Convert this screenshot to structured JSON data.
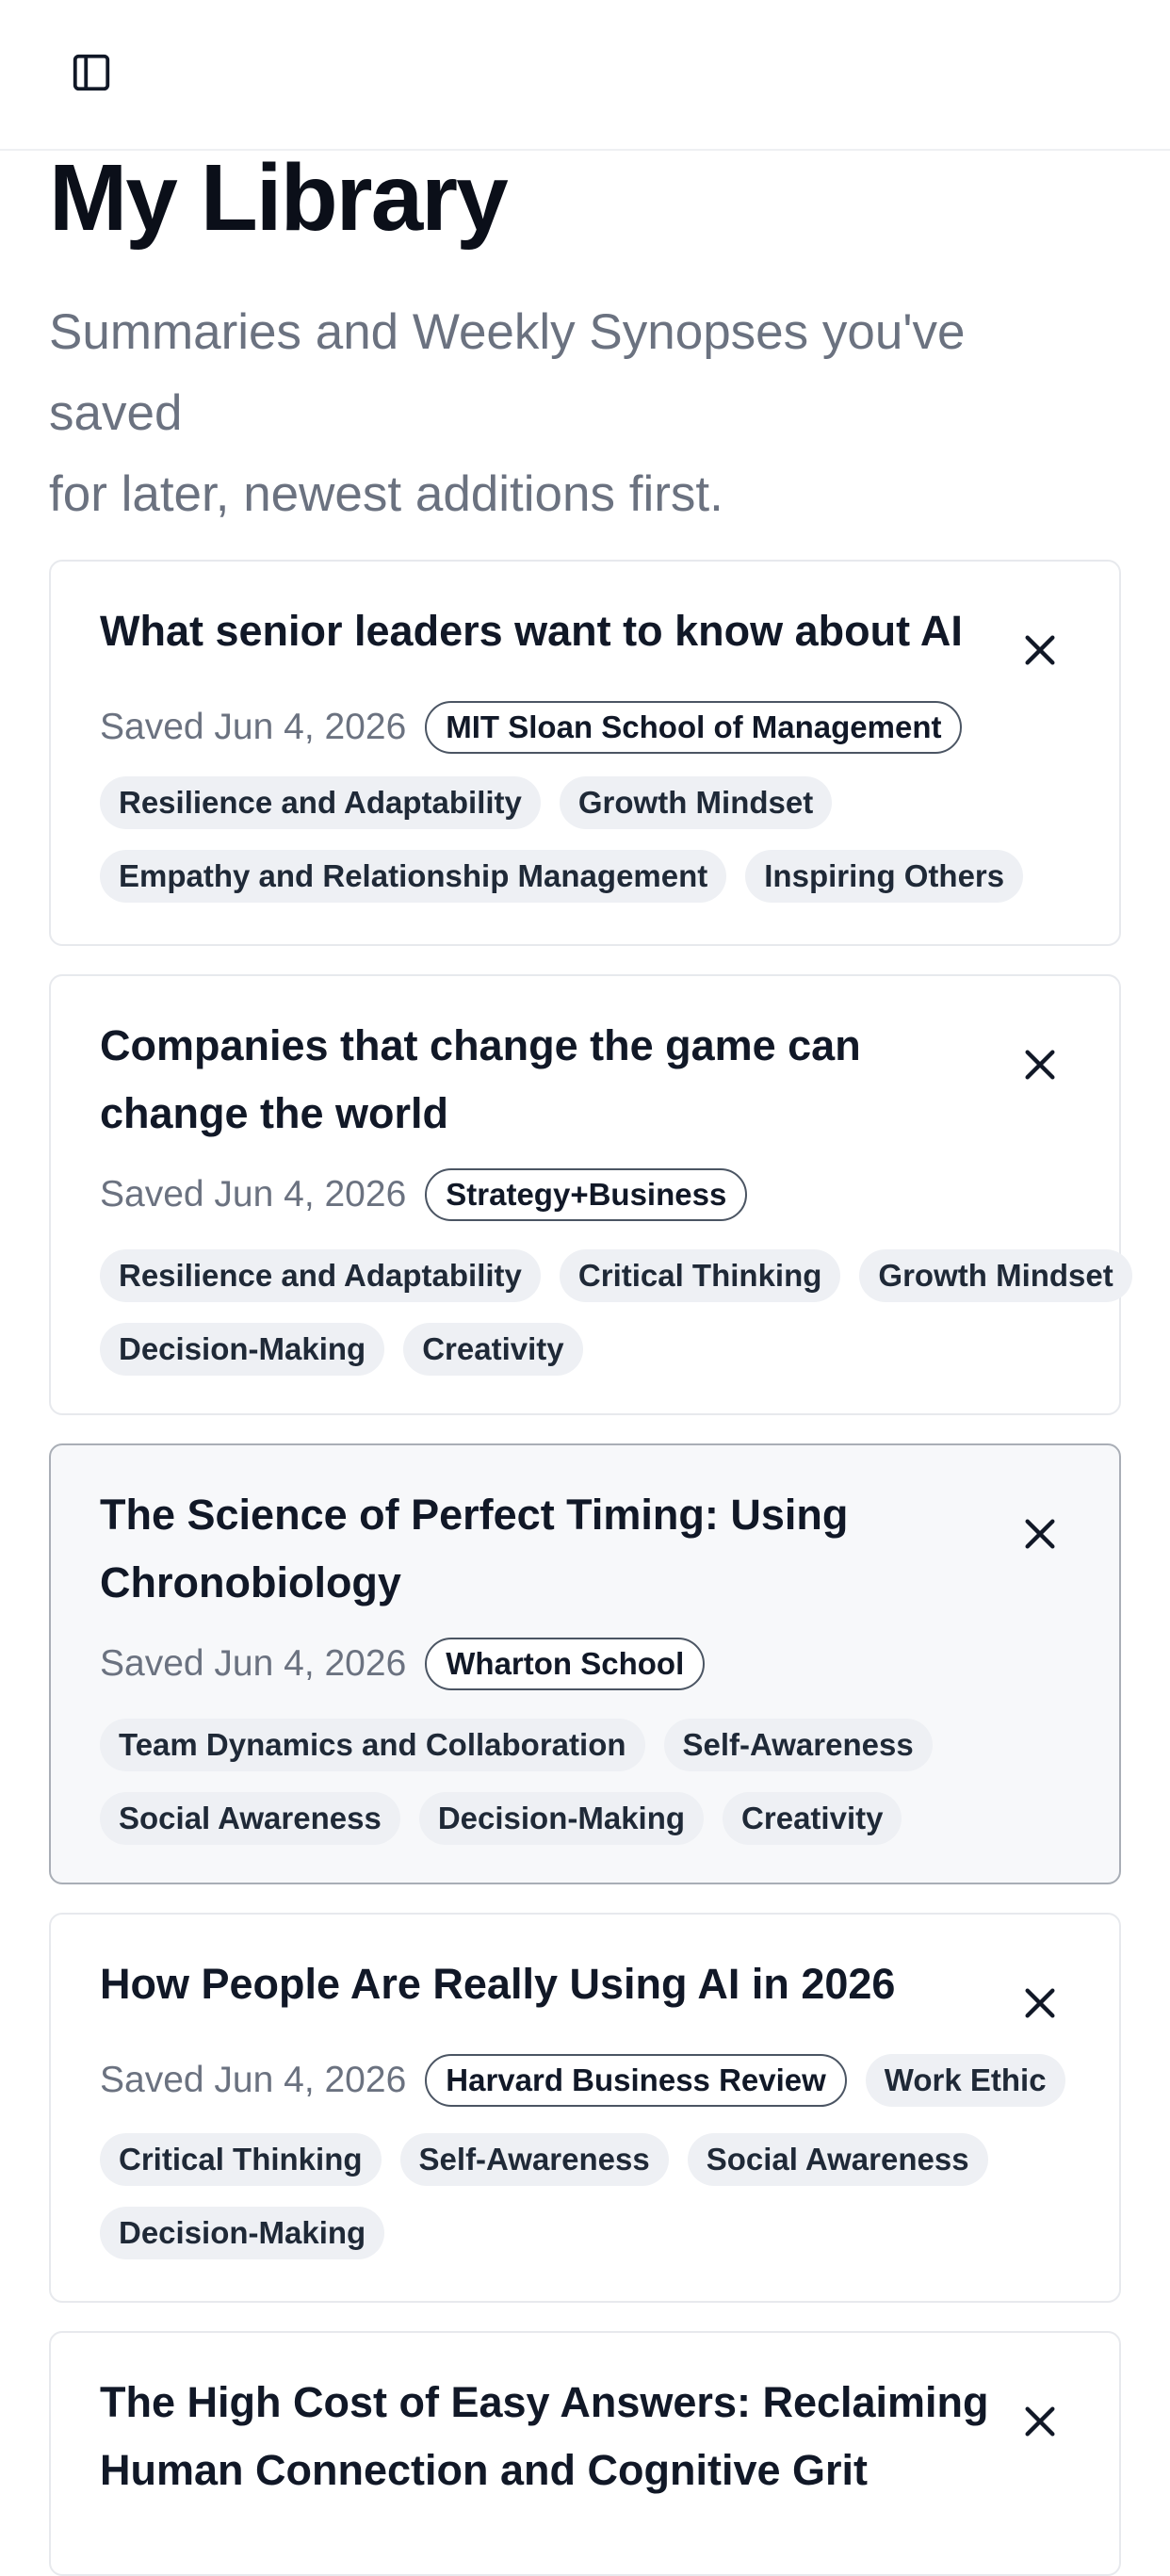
{
  "header": {
    "sidebar_icon": "sidebar-panel-icon"
  },
  "page": {
    "title": "My Library",
    "subtitle_line1": "Summaries and Weekly Synopses you've saved",
    "subtitle_line2": "for later, newest additions first."
  },
  "icons": {
    "remove": "close-icon"
  },
  "cards": [
    {
      "title": "What senior leaders want to know about AI",
      "saved": "Saved Jun 4, 2026",
      "source": "MIT Sloan School of Management",
      "tags": [
        "Resilience and Adaptability",
        "Growth Mindset",
        "Empathy and Relationship Management",
        "Inspiring Others"
      ]
    },
    {
      "title": "Companies that change the game can change the world",
      "saved": "Saved Jun 4, 2026",
      "source": "Strategy+Business",
      "tags": [
        "Resilience and Adaptability",
        "Critical Thinking",
        "Growth Mindset",
        "Decision-Making",
        "Creativity"
      ]
    },
    {
      "title": "The Science of Perfect Timing: Using Chronobiology",
      "saved": "Saved Jun 4, 2026",
      "source": "Wharton School",
      "tags": [
        "Team Dynamics and Collaboration",
        "Self-Awareness",
        "Social Awareness",
        "Decision-Making",
        "Creativity"
      ]
    },
    {
      "title": "How People Are Really Using AI in 2026",
      "saved": "Saved Jun 4, 2026",
      "source": "Harvard Business Review",
      "tags": [
        "Work Ethic",
        "Critical Thinking",
        "Self-Awareness",
        "Social Awareness",
        "Decision-Making"
      ]
    },
    {
      "title": "The High Cost of Easy Answers: Reclaiming Human Connection and Cognitive Grit"
    }
  ],
  "colors": {
    "title": "#0b0f19",
    "subtitle": "#6b7280",
    "tag_bg": "#eef0f4",
    "card_border": "#e7e9ed",
    "highlight_bg": "#f7f8fa"
  }
}
